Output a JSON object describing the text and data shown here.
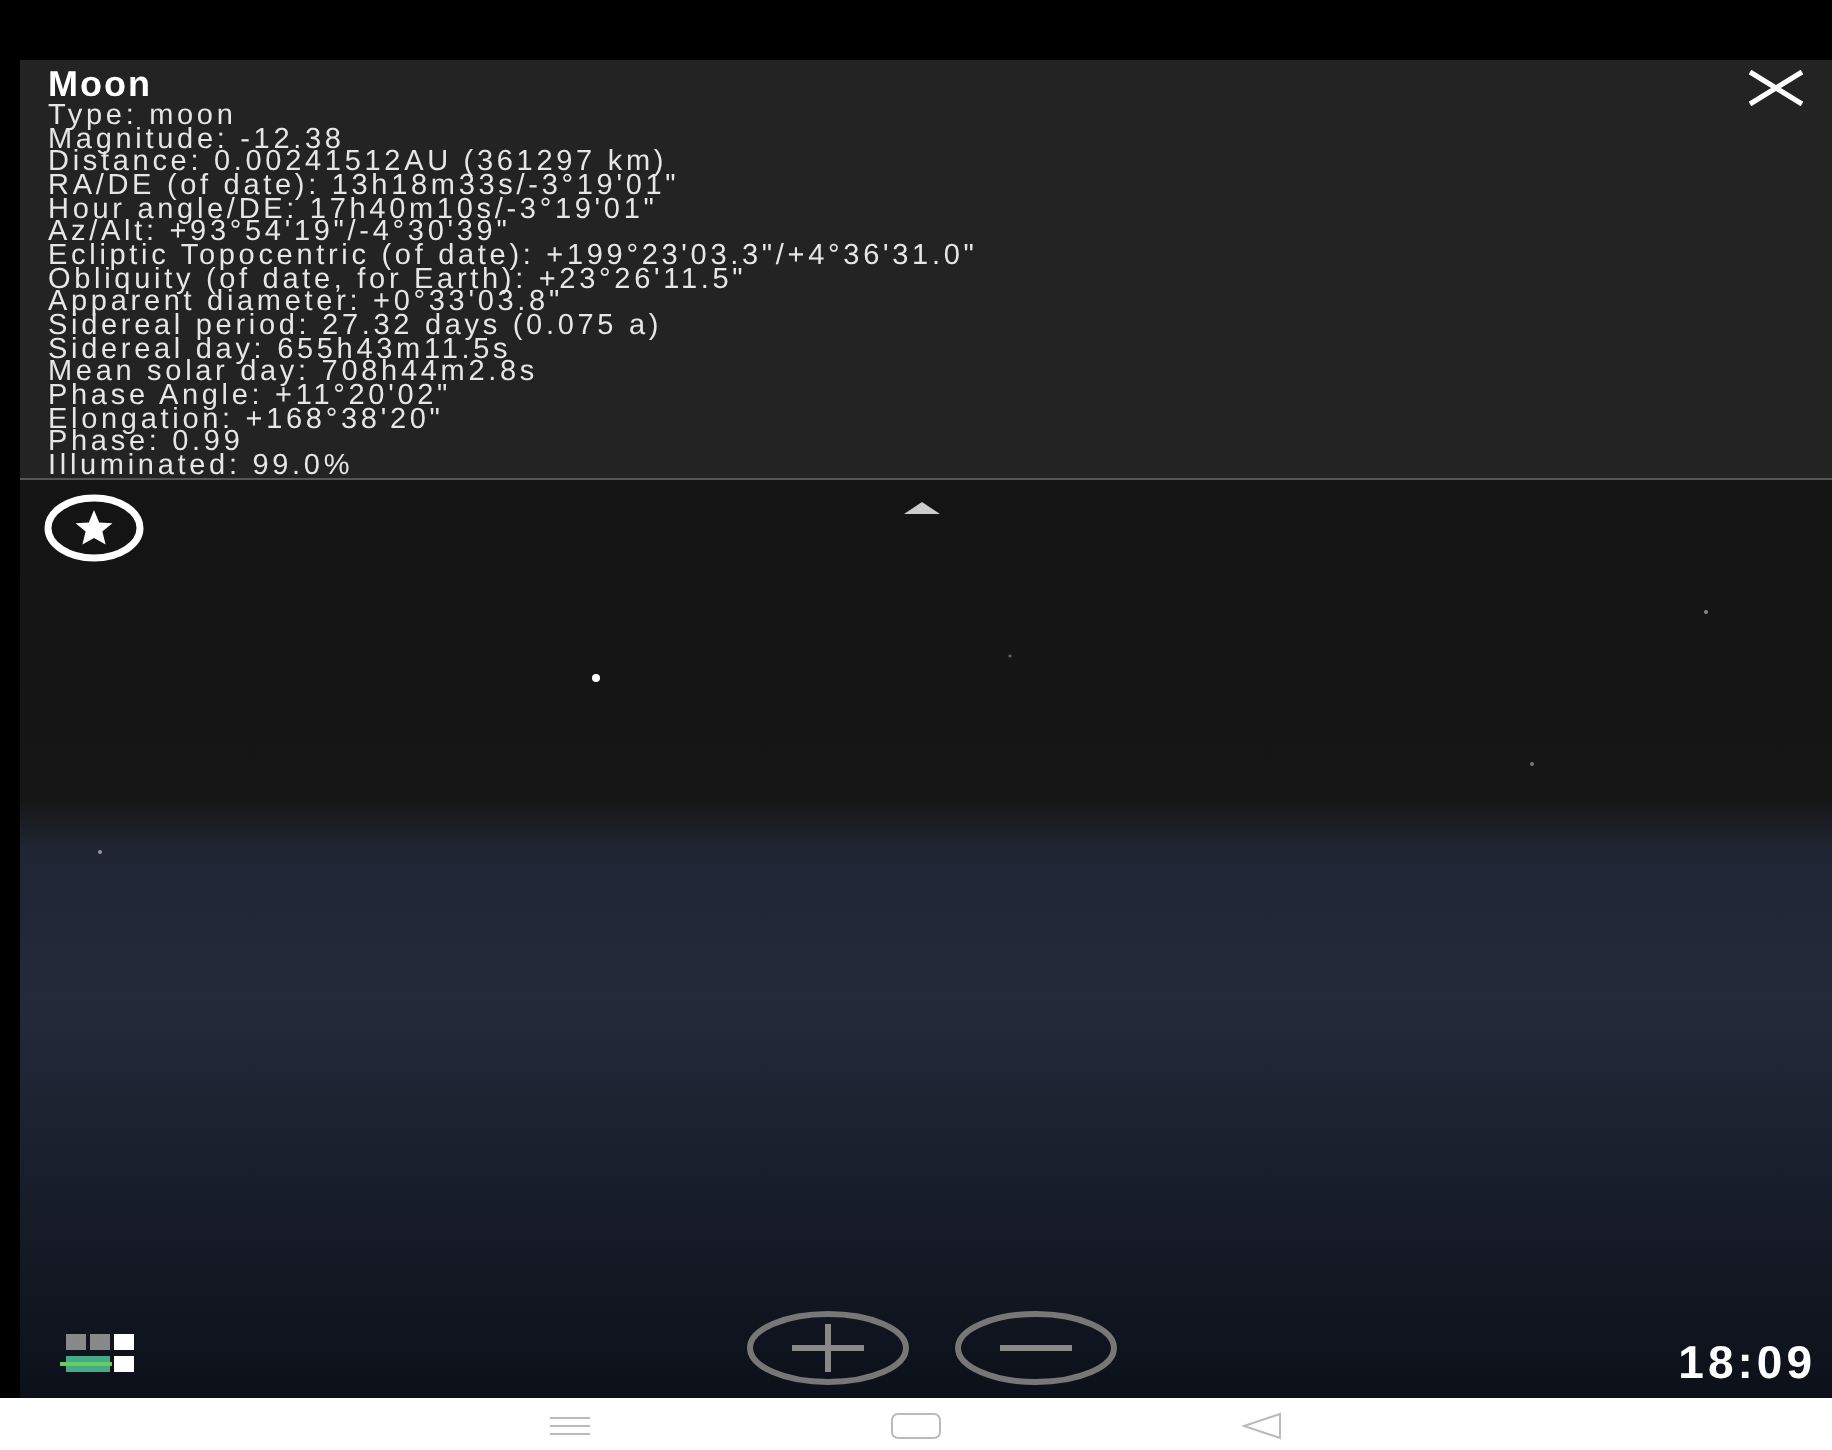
{
  "info_panel": {
    "title": "Moon",
    "lines": [
      "Type: moon",
      "Magnitude: -12.38",
      "Distance: 0.00241512AU (361297 km)",
      "RA/DE (of date): 13h18m33s/-3°19'01\"",
      "Hour angle/DE: 17h40m10s/-3°19'01\"",
      "Az/Alt: +93°54'19\"/-4°30'39\"",
      "Ecliptic Topocentric (of date): +199°23'03.3\"/+4°36'31.0\"",
      "Obliquity (of date, for Earth): +23°26'11.5\"",
      "Apparent diameter: +0°33'03.8\"",
      "Sidereal period: 27.32 days (0.075 a)",
      "Sidereal day: 655h43m11.5s",
      "Mean solar day: 708h44m2.8s",
      "Phase Angle: +11°20'02\"",
      "Elongation: +168°38'20\"",
      "Phase: 0.99",
      "Illuminated: 99.0%"
    ]
  },
  "clock": "18:09"
}
